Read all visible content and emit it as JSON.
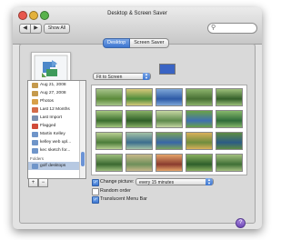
{
  "window": {
    "title": "Desktop & Screen Saver",
    "back_label": "◀",
    "forward_label": "▶",
    "show_all_label": "Show All",
    "search_value": ""
  },
  "tabs": [
    {
      "label": "Desktop",
      "active": true
    },
    {
      "label": "Screen Saver",
      "active": false
    }
  ],
  "fit": {
    "selected": "Fit to Screen"
  },
  "desktop_color": "#3a64c4",
  "sources": [
    {
      "label": "Aug 21, 2008",
      "icon": "event-icon",
      "color": "#c59a4d"
    },
    {
      "label": "Aug 27, 2008",
      "icon": "event-icon",
      "color": "#c59a4d"
    },
    {
      "label": "Photos",
      "icon": "photos-icon",
      "color": "#d8a049"
    },
    {
      "label": "Last 12 Months",
      "icon": "calendar-icon",
      "color": "#d36b4a"
    },
    {
      "label": "Last Import",
      "icon": "import-icon",
      "color": "#7b8fb0"
    },
    {
      "label": "Flagged",
      "icon": "flag-icon",
      "color": "#d14b3a"
    },
    {
      "label": "Martin Kelley",
      "icon": "album-icon",
      "color": "#6f95c9"
    },
    {
      "label": "kelley web upl...",
      "icon": "album-icon",
      "color": "#6f95c9"
    },
    {
      "label": "kec sketch for...",
      "icon": "album-icon",
      "color": "#6f95c9"
    }
  ],
  "folders": {
    "header": "Folders",
    "items": [
      {
        "label": "golf desktops",
        "icon": "folder-icon",
        "color": "#6f95c9"
      }
    ]
  },
  "thumbnails": [
    {
      "c1": "#5b8a3a",
      "c2": "#a7c48b"
    },
    {
      "c1": "#4e8c3a",
      "c2": "#d6c97a"
    },
    {
      "c1": "#2d5aa6",
      "c2": "#7ea7d8"
    },
    {
      "c1": "#476f34",
      "c2": "#8cb36c"
    },
    {
      "c1": "#345f2a",
      "c2": "#9cc07a"
    },
    {
      "c1": "#3a6d2d",
      "c2": "#a5c77f"
    },
    {
      "c1": "#2f5f28",
      "c2": "#88b066"
    },
    {
      "c1": "#5e8a4b",
      "c2": "#c5d6a2"
    },
    {
      "c1": "#3f70b0",
      "c2": "#6aa248"
    },
    {
      "c1": "#2f6c3a",
      "c2": "#86b76b"
    },
    {
      "c1": "#4b7c39",
      "c2": "#b8cf92"
    },
    {
      "c1": "#3c6e8e",
      "c2": "#a3c2a5"
    },
    {
      "c1": "#3766a7",
      "c2": "#7aa25c"
    },
    {
      "c1": "#6f8d3e",
      "c2": "#d9b05a"
    },
    {
      "c1": "#2c5c86",
      "c2": "#5d8b43"
    },
    {
      "c1": "#3b6a31",
      "c2": "#9fbf7e"
    },
    {
      "c1": "#6e8f5a",
      "c2": "#c8b98a"
    },
    {
      "c1": "#8a3b2e",
      "c2": "#e6a56a"
    },
    {
      "c1": "#2e5f2b",
      "c2": "#8ab060"
    },
    {
      "c1": "#3f6f36",
      "c2": "#a4c07f"
    }
  ],
  "options": {
    "change_picture_label": "Change picture:",
    "change_picture_checked": true,
    "interval": "every 15 minutes",
    "random_order_label": "Random order",
    "random_order_checked": false,
    "translucent_menu_bar_label": "Translucent Menu Bar",
    "translucent_menu_bar_checked": true
  },
  "controls": {
    "add_label": "+",
    "remove_label": "−",
    "help_label": "?"
  }
}
